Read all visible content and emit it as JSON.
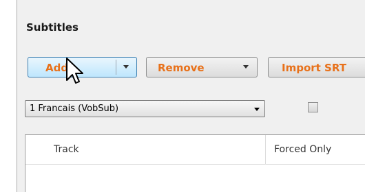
{
  "section": {
    "title": "Subtitles"
  },
  "toolbar": {
    "add_label": "Add",
    "remove_label": "Remove",
    "import_label": "Import SRT"
  },
  "track_select": {
    "selected": "1 Francais (VobSub)"
  },
  "forced_checkbox": {
    "checked": false
  },
  "table": {
    "columns": [
      "Track",
      "Forced Only"
    ]
  },
  "colors": {
    "button_text": "#e8711a",
    "hover_border": "#3c7fb1"
  }
}
